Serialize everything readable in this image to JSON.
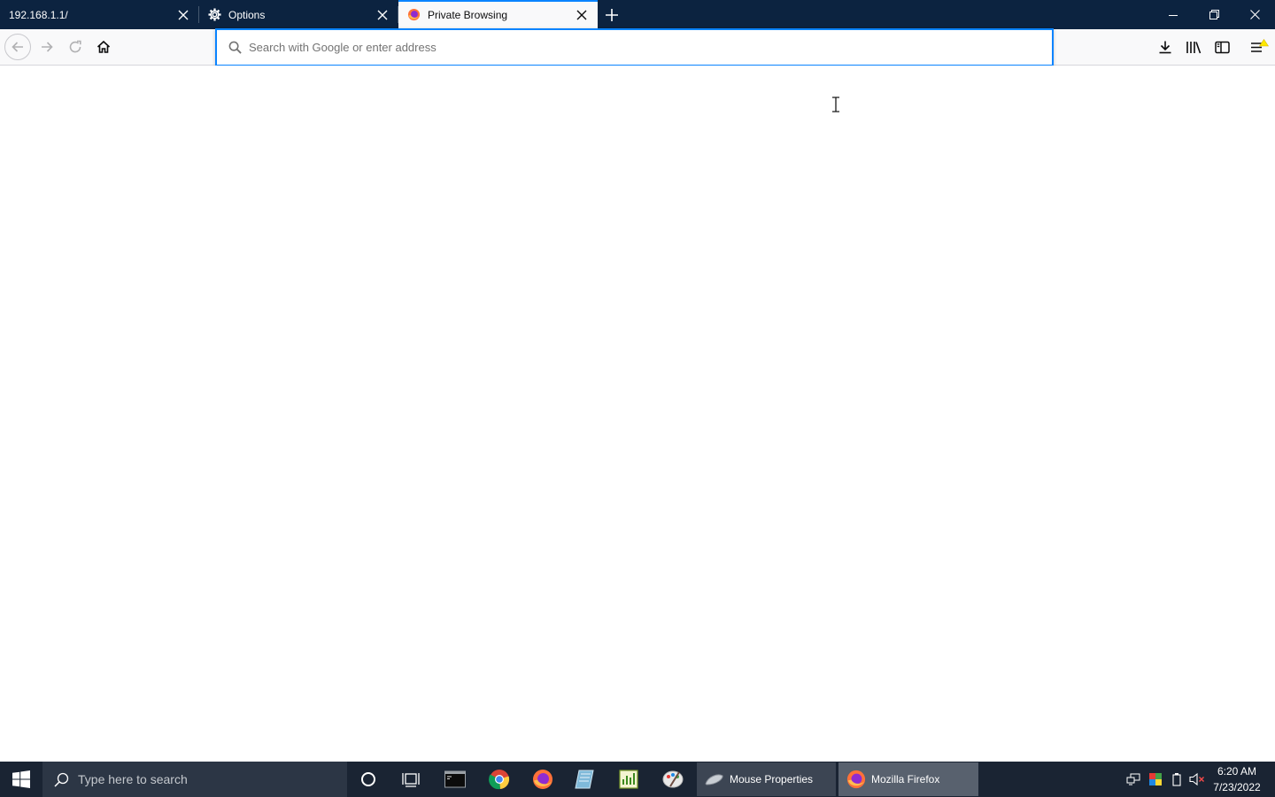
{
  "browser": {
    "tabs": [
      {
        "title": "192.168.1.1/",
        "icon": "none",
        "active": false
      },
      {
        "title": "Options",
        "icon": "gear-icon",
        "active": false
      },
      {
        "title": "Private Browsing",
        "icon": "firefox-icon",
        "active": true
      }
    ],
    "urlbar": {
      "placeholder": "Search with Google or enter address",
      "value": ""
    }
  },
  "taskbar": {
    "search_placeholder": "Type here to search",
    "pinned_apps": [
      "cortana-icon",
      "task-view-icon",
      "terminal-icon",
      "chrome-icon",
      "firefox-icon",
      "notepad-icon",
      "spreadsheet-icon",
      "paint-icon"
    ],
    "windows": [
      {
        "label": "Mouse Properties",
        "icon": "mouse-icon"
      },
      {
        "label": "Mozilla Firefox",
        "icon": "firefox-icon"
      }
    ],
    "clock": {
      "time": "6:20 AM",
      "date": "7/23/2022"
    }
  },
  "colors": {
    "titlebar": "#0c2340",
    "accent": "#0a84ff",
    "taskbar": "#1a2433"
  }
}
